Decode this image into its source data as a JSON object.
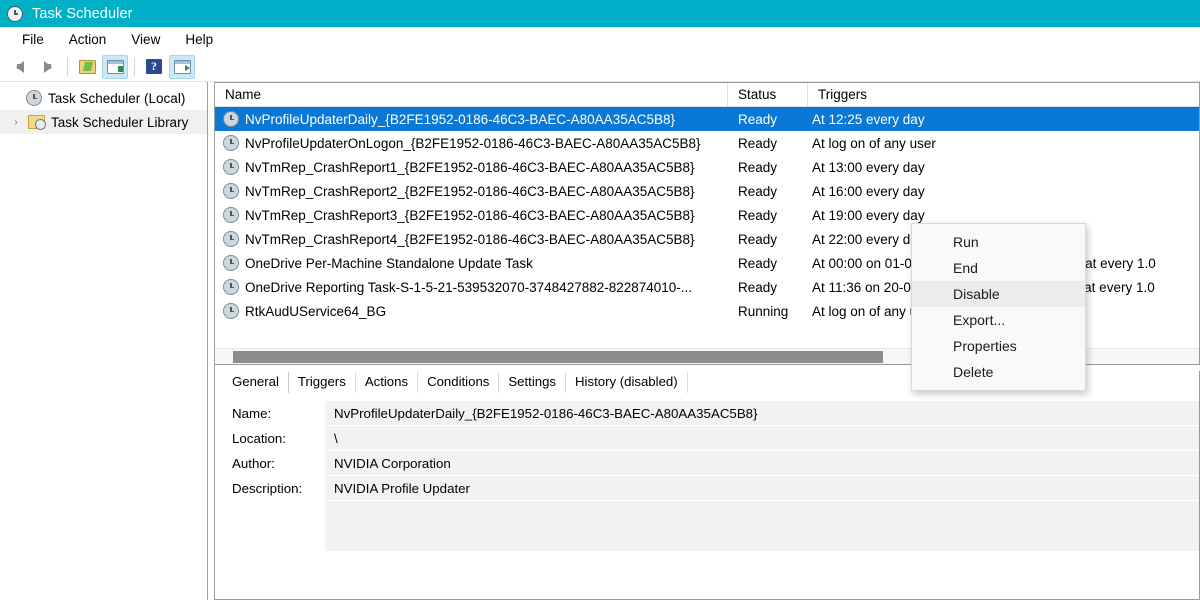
{
  "window": {
    "title": "Task Scheduler",
    "title_icon": "clock-icon",
    "accent_color": "#00b0c7",
    "selection_color": "#0a78d4"
  },
  "menubar": {
    "items": [
      {
        "label": "File"
      },
      {
        "label": "Action"
      },
      {
        "label": "View"
      },
      {
        "label": "Help"
      }
    ]
  },
  "toolbar": {
    "items": [
      {
        "name": "back-arrow-icon",
        "label": "Back"
      },
      {
        "name": "forward-arrow-icon",
        "label": "Forward"
      },
      {
        "name": "new-folder-icon",
        "label": "New Folder"
      },
      {
        "name": "show-console-tree-icon",
        "label": "Show/Hide Console Tree"
      },
      {
        "name": "help-icon",
        "label": "Help"
      },
      {
        "name": "show-action-pane-icon",
        "label": "Show/Hide Action Pane"
      }
    ]
  },
  "tree": {
    "root": {
      "label": "Task Scheduler (Local)",
      "icon": "clock-icon"
    },
    "child": {
      "label": "Task Scheduler Library",
      "icon": "library-folder-icon",
      "chevron": "›"
    }
  },
  "list": {
    "columns": [
      {
        "key": "name",
        "label": "Name"
      },
      {
        "key": "status",
        "label": "Status"
      },
      {
        "key": "triggers",
        "label": "Triggers"
      }
    ],
    "rows": [
      {
        "name": "NvProfileUpdaterDaily_{B2FE1952-0186-46C3-BAEC-A80AA35AC5B8}",
        "status": "Ready",
        "triggers": "At 12:25 every day",
        "selected": true
      },
      {
        "name": "NvProfileUpdaterOnLogon_{B2FE1952-0186-46C3-BAEC-A80AA35AC5B8}",
        "status": "Ready",
        "triggers": "At log on of any user",
        "selected": false
      },
      {
        "name": "NvTmRep_CrashReport1_{B2FE1952-0186-46C3-BAEC-A80AA35AC5B8}",
        "status": "Ready",
        "triggers": "At 13:00 every day",
        "selected": false
      },
      {
        "name": "NvTmRep_CrashReport2_{B2FE1952-0186-46C3-BAEC-A80AA35AC5B8}",
        "status": "Ready",
        "triggers": "At 16:00 every day",
        "selected": false
      },
      {
        "name": "NvTmRep_CrashReport3_{B2FE1952-0186-46C3-BAEC-A80AA35AC5B8}",
        "status": "Ready",
        "triggers": "At 19:00 every day",
        "selected": false
      },
      {
        "name": "NvTmRep_CrashReport4_{B2FE1952-0186-46C3-BAEC-A80AA35AC5B8}",
        "status": "Ready",
        "triggers": "At 22:00 every day",
        "selected": false
      },
      {
        "name": "OneDrive Per-Machine Standalone Update Task",
        "status": "Ready",
        "triggers": "At 00:00 on 01-05-1992 - After triggered, repeat every 1.0",
        "selected": false
      },
      {
        "name": "OneDrive Reporting Task-S-1-5-21-539532070-3748427882-822874010-...",
        "status": "Ready",
        "triggers": "At 11:36 on 20-07-2022 - After triggered, repeat every 1.0",
        "selected": false
      },
      {
        "name": "RtkAudUService64_BG",
        "status": "Running",
        "triggers": "At log on of any user",
        "selected": false
      }
    ]
  },
  "context_menu": {
    "items": [
      {
        "label": "Run",
        "highlighted": false
      },
      {
        "label": "End",
        "highlighted": false
      },
      {
        "label": "Disable",
        "highlighted": true
      },
      {
        "label": "Export...",
        "highlighted": false
      },
      {
        "label": "Properties",
        "highlighted": false
      },
      {
        "label": "Delete",
        "highlighted": false
      }
    ]
  },
  "details": {
    "tabs": [
      {
        "label": "General",
        "active": true
      },
      {
        "label": "Triggers",
        "active": false
      },
      {
        "label": "Actions",
        "active": false
      },
      {
        "label": "Conditions",
        "active": false
      },
      {
        "label": "Settings",
        "active": false
      },
      {
        "label": "History (disabled)",
        "active": false
      }
    ],
    "fields": [
      {
        "label": "Name:",
        "value": "NvProfileUpdaterDaily_{B2FE1952-0186-46C3-BAEC-A80AA35AC5B8}"
      },
      {
        "label": "Location:",
        "value": "\\"
      },
      {
        "label": "Author:",
        "value": "NVIDIA Corporation"
      },
      {
        "label": "Description:",
        "value": "NVIDIA Profile Updater"
      }
    ]
  }
}
